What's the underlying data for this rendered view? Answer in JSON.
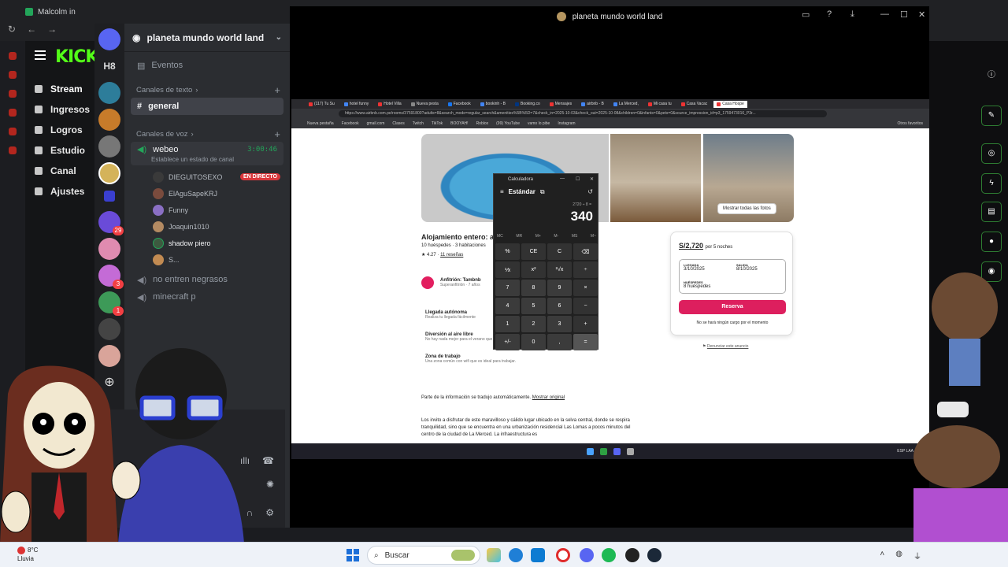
{
  "browser": {
    "tab_title": "Malcolm in",
    "nav_back": "←",
    "nav_forward": "→",
    "nav_reload": "↻"
  },
  "kick": {
    "logo": "KICK",
    "menu": [
      {
        "label": "Stream",
        "icon": "broadcast-icon"
      },
      {
        "label": "Ingresos",
        "icon": "chart-icon"
      },
      {
        "label": "Logros",
        "icon": "trophy-icon"
      },
      {
        "label": "Estudio",
        "icon": "studio-icon"
      },
      {
        "label": "Canal",
        "icon": "channel-icon"
      },
      {
        "label": "Ajustes",
        "icon": "gear-icon"
      }
    ]
  },
  "discord": {
    "rail_label": "H8",
    "server_name": "planeta mundo world land",
    "events_label": "Eventos",
    "text_category": "Canales de texto",
    "text_channel": "general",
    "voice_category": "Canales de voz",
    "voice_channel": "webeo",
    "voice_time": "3:00:46",
    "voice_status": "Establece un estado de canal",
    "members": [
      {
        "name": "DIEGUITOSEXO",
        "live": "EN DIRECTO"
      },
      {
        "name": "ElAguSapeKRJ"
      },
      {
        "name": "Funny"
      },
      {
        "name": "Joaquin1010"
      },
      {
        "name": "shadow piero"
      },
      {
        "name": "S..."
      }
    ],
    "other_voice": [
      "no entren negrasos",
      "minecraft p"
    ],
    "badges": [
      "29",
      "3",
      "1"
    ]
  },
  "stream_window": {
    "title": "planeta mundo world land"
  },
  "inner_browser": {
    "url": "https://www.airbnb.com.pe/rooms/37591800?adults=8&search_mode=regular_search&amenities%5B%5D=7&check_in=2025-10-03&check_out=2025-10-08&children=0&infants=0&pets=0&source_impression_id=p3_1759473016_P3r...",
    "tabs": [
      "(117) Tu Su",
      "hotel funny",
      "Hotel Villa",
      "Nueva pesta",
      "Facebook",
      "bookinh - B",
      "Booking.co",
      "Mensajes",
      "airbnb - B",
      "La Merced,",
      "Mi casa tu",
      "Casa Vacac",
      "Casa Hospe"
    ],
    "bookmarks": [
      "Nueva pestaña",
      "Facebook",
      "gmail.com",
      "Clases",
      "Twitch",
      "TikTok",
      "BOOYAH!",
      "Roblox",
      "(99) YouTube",
      "vamo lo pibe",
      "Instagram",
      "Otros favoritos"
    ],
    "show_all_photos": "Mostrar todas las fotos",
    "title": "Alojamiento entero: a",
    "subtitle": "10 huéspedes · 3 habitaciones",
    "rating": "4.27",
    "reviews": "11 reseñas",
    "host": "Anfitrión: Tambnb",
    "host_sub": "Superanfitrión · 7 años",
    "features": [
      {
        "title": "Llegada autónoma",
        "desc": "Realiza tu llegada fácilmente"
      },
      {
        "title": "Diversión al aire libre",
        "desc": "No hay nada mejor para el verano que una piscina y parrilla."
      },
      {
        "title": "Zona de trabajo",
        "desc": "Una zona común con wifi que es ideal para trabajar."
      }
    ],
    "translate_note": "Parte de la información se tradujo automáticamente.",
    "translate_link": "Mostrar original",
    "description": "Los invito a disfrutar de este maravilloso y cálido lugar ubicado en la selva central, donde se respira tranquilidad, sino que se encuentra en una urbanización residencial Las Lomas a pocos minutos del centro de la ciudad de La Merced. La infraestructura es",
    "booking": {
      "price": "S/2,720",
      "nights": "por 5 noches",
      "checkin_label": "LLEGADA",
      "checkin": "3/10/2025",
      "checkout_label": "SALIDA",
      "checkout": "8/10/2025",
      "guests_label": "HUÉSPEDES",
      "guests": "8 huéspedes",
      "reserve": "Reserva",
      "no_charge": "No se hará ningún cargo por el momento"
    },
    "report": "Denunciar este anuncio",
    "tray_lang": "ESP LAA"
  },
  "calculator": {
    "title": "Calculadora",
    "mode": "Estándar",
    "expression": "2720 ÷ 8 =",
    "display": "340",
    "memory": [
      "MC",
      "MR",
      "M+",
      "M-",
      "MS",
      "M~"
    ],
    "keys": [
      "%",
      "CE",
      "C",
      "⌫",
      "⅟x",
      "x²",
      "²√x",
      "÷",
      "7",
      "8",
      "9",
      "×",
      "4",
      "5",
      "6",
      "−",
      "1",
      "2",
      "3",
      "+",
      "+/-",
      "0",
      ",",
      "="
    ]
  },
  "taskbar": {
    "temp": "8°C",
    "weather": "Lluvia",
    "search_placeholder": "Buscar"
  }
}
